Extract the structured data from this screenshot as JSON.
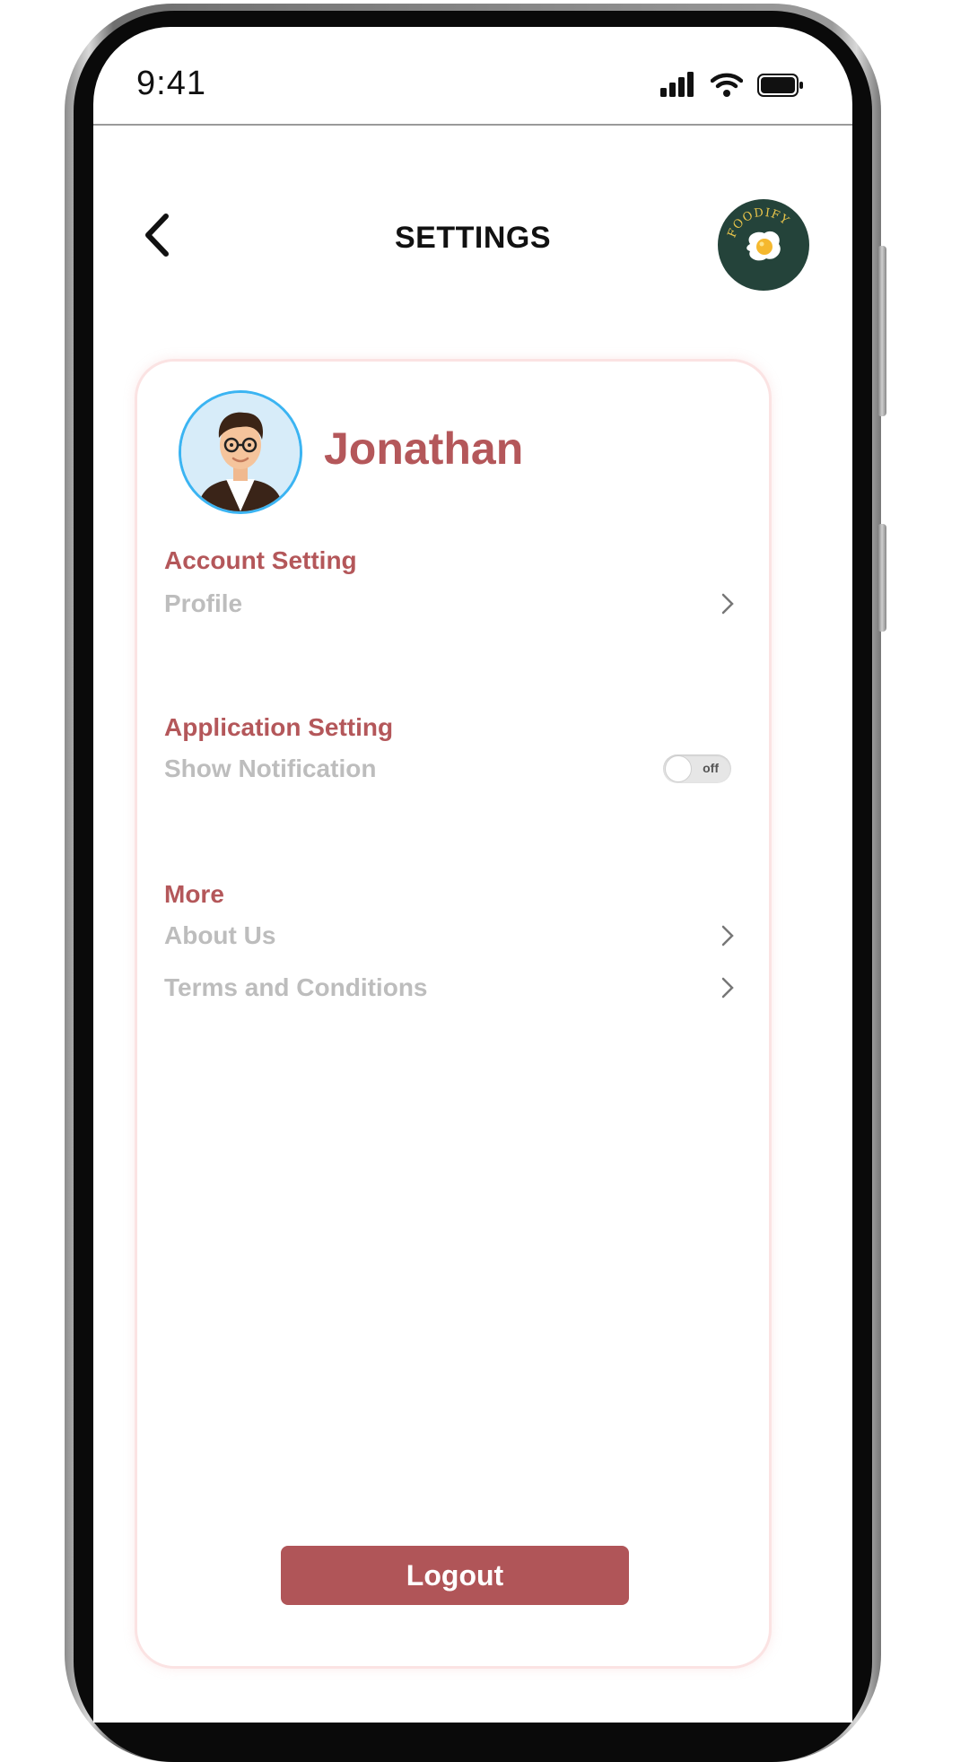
{
  "status_bar": {
    "time": "9:41",
    "icons": [
      "signal-icon",
      "wifi-icon",
      "battery-icon"
    ]
  },
  "header": {
    "title": "SETTINGS",
    "back_icon": "chevron-left-icon",
    "logo_text": "FOODIFY"
  },
  "profile": {
    "name": "Jonathan"
  },
  "sections": {
    "account": {
      "title": "Account Setting",
      "items": [
        {
          "label": "Profile"
        }
      ]
    },
    "application": {
      "title": "Application Setting",
      "items": [
        {
          "label": "Show Notification",
          "toggle_state": "off"
        }
      ]
    },
    "more": {
      "title": "More",
      "items": [
        {
          "label": "About Us"
        },
        {
          "label": "Terms and Conditions"
        }
      ]
    }
  },
  "footer": {
    "logout_label": "Logout"
  },
  "colors": {
    "accent": "#b4575a",
    "button": "#b05558",
    "muted_text": "#bdbdbd",
    "logo_bg": "#24433a"
  }
}
